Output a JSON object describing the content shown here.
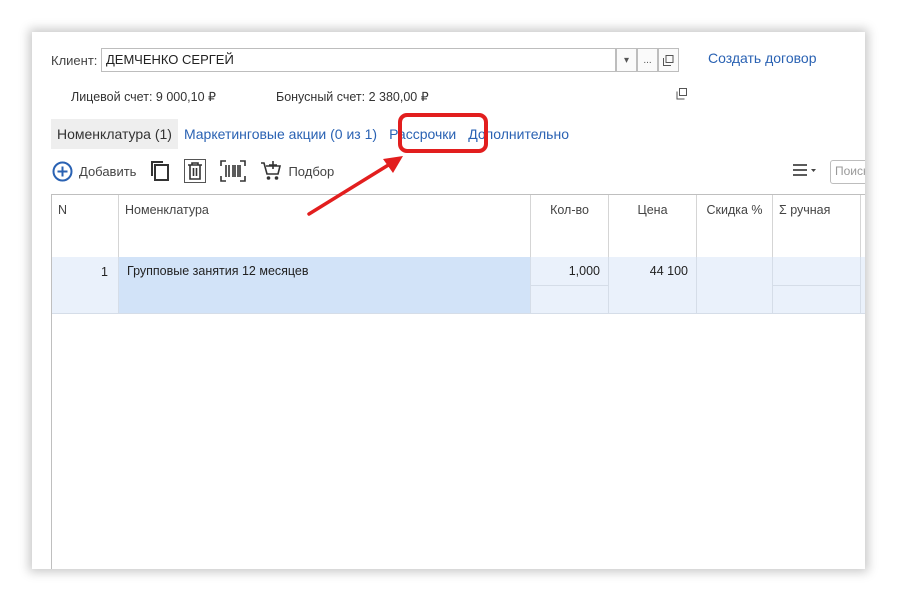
{
  "client": {
    "label": "Клиент:",
    "value": "ДЕМЧЕНКО СЕРГЕЙ",
    "dropdown_glyph": "▾",
    "more_glyph": "...",
    "create_link": "Создать договор"
  },
  "accounts": {
    "personal": "Лицевой счет: 9 000,10 ₽",
    "bonus": "Бонусный счет: 2 380,00 ₽"
  },
  "tabs": [
    {
      "label": "Номенклатура (1)"
    },
    {
      "label": "Маркетинговые акции (0 из 1)"
    },
    {
      "label": "Рассрочки"
    },
    {
      "label": "Дополнительно"
    }
  ],
  "toolbar": {
    "add_label": "Добавить",
    "pick_label": "Подбор",
    "search_placeholder": "Поиск",
    "icons": [
      "plus-circle-icon",
      "copy-icon",
      "delete-icon",
      "barcode-icon",
      "cart-icon",
      "menu-icon"
    ]
  },
  "table": {
    "columns": [
      "N",
      "Номенклатура",
      "Кол-во",
      "Цена",
      "Скидка %",
      "Σ ручная"
    ],
    "rows": [
      {
        "n": "1",
        "name": "Групповые занятия 12 месяцев",
        "qty": "1,000",
        "price": "44 100",
        "discount": "",
        "manual": ""
      }
    ]
  },
  "colors": {
    "link": "#2a62b3",
    "annotation": "#e21e1e",
    "selected_row": "#eaf1fb",
    "selected_cell": "#d2e3f8"
  }
}
